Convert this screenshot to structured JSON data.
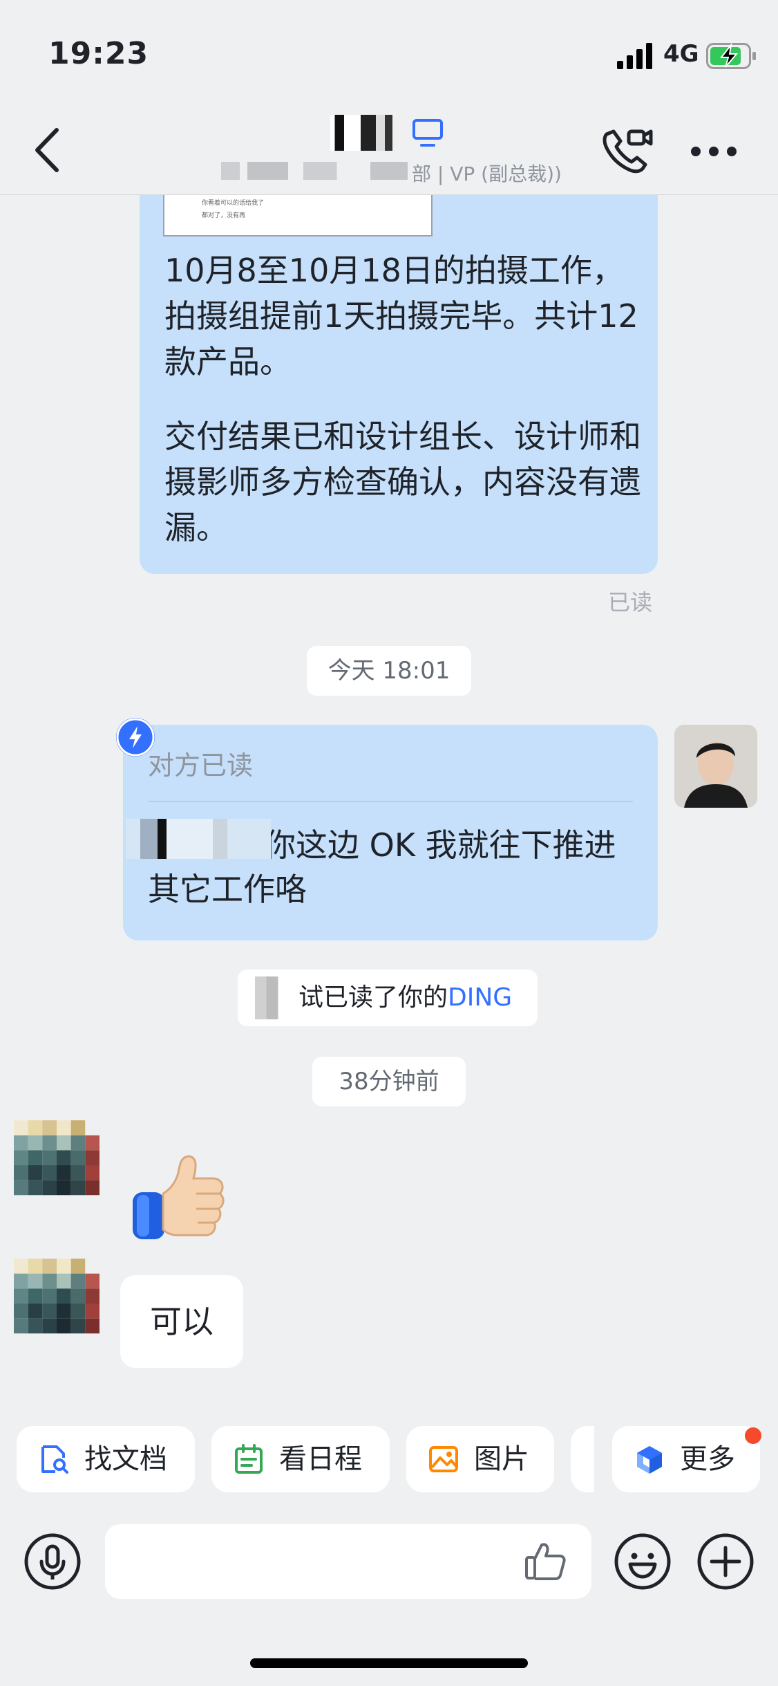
{
  "status_bar": {
    "time": "19:23",
    "network": "4G"
  },
  "header": {
    "subtitle": "部 | VP (副总裁))",
    "icons": [
      "back-icon",
      "device-icon",
      "video-call-icon",
      "more-icon"
    ]
  },
  "messages": [
    {
      "paragraph1": "10月8至10月18日的拍摄工作，拍摄组提前1天拍摄完毕。共计12款产品。",
      "paragraph2": "交付结果已和设计组长、设计师和摄影师多方检查确认，内容没有遗漏。",
      "thumb_line1": "你看着可以的话给我了",
      "thumb_line2": "都对了，没有再",
      "read_status": "已读"
    },
    {
      "timestamp": "今天 18:01"
    },
    {
      "read_notice": "对方已读",
      "text": "你这边 OK 我就往下推进其它工作咯"
    },
    {
      "ding_prefix": "试已读了你的",
      "ding_label": "DING"
    },
    {
      "timestamp": "38分钟前"
    },
    {
      "sticker": "thumbs-up"
    },
    {
      "text": "可以"
    }
  ],
  "quick_actions": [
    {
      "label": "找文档",
      "icon": "doc-search-icon",
      "color": "#3370ff"
    },
    {
      "label": "看日程",
      "icon": "calendar-icon",
      "color": "#34a853"
    },
    {
      "label": "图片",
      "icon": "image-icon",
      "color": "#ff8800"
    },
    {
      "label": "更多",
      "icon": "more-apps-icon",
      "color": "#3370ff"
    }
  ],
  "colors": {
    "accent": "#3370ff",
    "bubble": "#c6e0fb",
    "background": "#eff0f2",
    "badge": "#f54a2c"
  }
}
